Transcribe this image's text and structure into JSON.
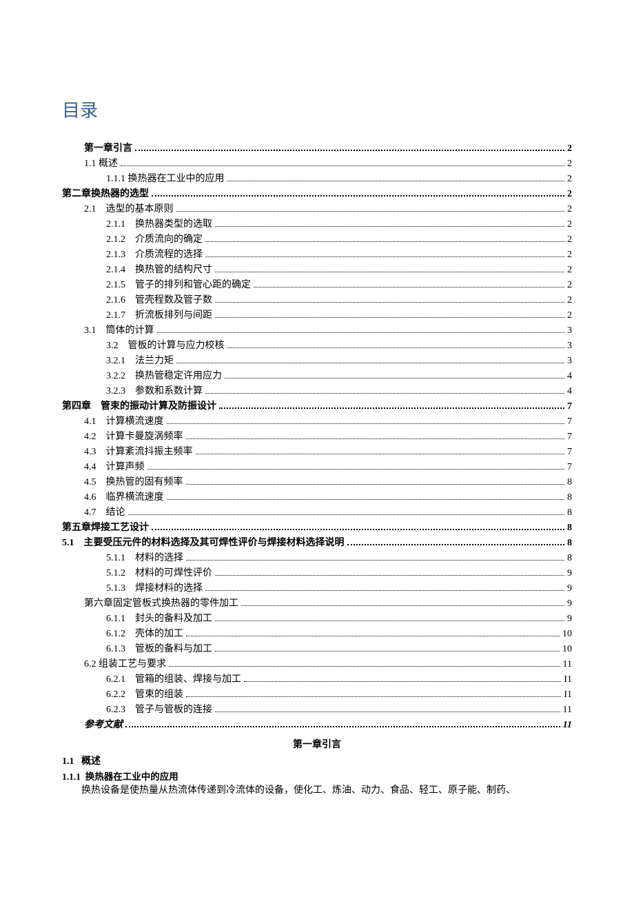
{
  "title": "目录",
  "toc": [
    {
      "indent": "ind0b",
      "num": "",
      "label": "第一章引言",
      "page": "2",
      "bold": true
    },
    {
      "indent": "ind1",
      "num": "",
      "label": "1.1 概述",
      "page": "2",
      "bold": false
    },
    {
      "indent": "ind2",
      "num": "",
      "label": "1.1.1 换热器在工业中的应用",
      "page": "2",
      "bold": false
    },
    {
      "indent": "ind0",
      "num": "",
      "label": "第二章换热器的选型",
      "page": "2",
      "bold": true
    },
    {
      "indent": "ind1",
      "num": "2.1",
      "label": "选型的基本原则",
      "page": "2",
      "bold": false
    },
    {
      "indent": "ind2",
      "num": "2.1.1",
      "label": "换热器类型的选取",
      "page": "2",
      "bold": false
    },
    {
      "indent": "ind2",
      "num": "2.1.2",
      "label": "介质流向的确定",
      "page": "2",
      "bold": false
    },
    {
      "indent": "ind2",
      "num": "2.1.3",
      "label": "介质流程的选择",
      "page": "2",
      "bold": false
    },
    {
      "indent": "ind2",
      "num": "2.1.4",
      "label": "换热管的结构尺寸",
      "page": "2",
      "bold": false
    },
    {
      "indent": "ind2",
      "num": "2.1.5",
      "label": "管子的排列和管心距的确定",
      "page": "2",
      "bold": false
    },
    {
      "indent": "ind2",
      "num": "2.1.6",
      "label": "管壳程数及管子数",
      "page": "2",
      "bold": false
    },
    {
      "indent": "ind2",
      "num": "2.1.7",
      "label": "折流板排列与间距",
      "page": "2",
      "bold": false
    },
    {
      "indent": "ind1",
      "num": "3.1",
      "label": "筒体的计算",
      "page": "3",
      "bold": false
    },
    {
      "indent": "ind2",
      "num": "3.2",
      "label": "管板的计算与应力校核",
      "page": "3",
      "bold": false
    },
    {
      "indent": "ind2",
      "num": "3.2.1",
      "label": "法兰力矩",
      "page": "3",
      "bold": false
    },
    {
      "indent": "ind2",
      "num": "3.2.2",
      "label": "换热管稳定许用应力",
      "page": "4",
      "bold": false
    },
    {
      "indent": "ind2",
      "num": "3.2.3",
      "label": "参数和系数计算",
      "page": "4",
      "bold": false
    },
    {
      "indent": "ind0",
      "num": "第四章",
      "label": "管束的振动计算及防振设计",
      "page": "7",
      "bold": true
    },
    {
      "indent": "ind1",
      "num": "4.1",
      "label": "计算横流速度",
      "page": "7",
      "bold": false
    },
    {
      "indent": "ind1",
      "num": "4.2",
      "label": "计算卡曼旋涡频率",
      "page": "7",
      "bold": false
    },
    {
      "indent": "ind1",
      "num": "4.3",
      "label": "计算紊流抖振主频率",
      "page": "7",
      "bold": false
    },
    {
      "indent": "ind1",
      "num": "4.4",
      "label": "计算声频",
      "page": "7",
      "bold": false
    },
    {
      "indent": "ind1",
      "num": "4.5",
      "label": "换热管的固有频率",
      "page": "8",
      "bold": false
    },
    {
      "indent": "ind1",
      "num": "4.6",
      "label": "临界横流速度",
      "page": "8",
      "bold": false
    },
    {
      "indent": "ind1",
      "num": "4.7",
      "label": "结论",
      "page": "8",
      "bold": false
    },
    {
      "indent": "ind0",
      "num": "",
      "label": "第五章焊接工艺设计",
      "page": "8",
      "bold": true
    },
    {
      "indent": "ind0",
      "num": "5.1",
      "label": "主要受压元件的材料选择及其可焊性评价与焊接材料选择说明",
      "page": "8",
      "bold": true
    },
    {
      "indent": "ind2",
      "num": "5.1.1",
      "label": "材料的选择",
      "page": "8",
      "bold": false
    },
    {
      "indent": "ind2",
      "num": "5.1.2",
      "label": "材料的可焊性评价",
      "page": "9",
      "bold": false
    },
    {
      "indent": "ind2",
      "num": "5.1.3",
      "label": "焊接材料的选择",
      "page": "9",
      "bold": false
    },
    {
      "indent": "ind1",
      "num": "",
      "label": "第六章固定管板式换热器的零件加工",
      "page": "9",
      "bold": false
    },
    {
      "indent": "ind2",
      "num": "6.1.1",
      "label": "封头的备料及加工",
      "page": "9",
      "bold": false
    },
    {
      "indent": "ind2",
      "num": "6.1.2",
      "label": "壳体的加工",
      "page": "10",
      "bold": false
    },
    {
      "indent": "ind2",
      "num": "6.1.3",
      "label": "管板的备料与加工",
      "page": "10",
      "bold": false
    },
    {
      "indent": "ind1",
      "num": "",
      "label": "6.2 组装工艺与要求",
      "page": "11",
      "bold": false
    },
    {
      "indent": "ind2",
      "num": "6.2.1",
      "label": "管箱的组装、焊接与加工",
      "page": "I1",
      "bold": false
    },
    {
      "indent": "ind2",
      "num": "6.2.2",
      "label": "管束的组装",
      "page": "I1",
      "bold": false
    },
    {
      "indent": "ind2",
      "num": "6.2.3",
      "label": "管子与管板的连接",
      "page": "11",
      "bold": false
    },
    {
      "indent": "ind1",
      "num": "",
      "label": "参考文献",
      "page": "11",
      "bold": true,
      "italic": true
    }
  ],
  "body": {
    "chapter_heading": "第一章引言",
    "sec1_num": "1.1",
    "sec1_label": "概述",
    "sec11_num": "1.1.1",
    "sec11_label": "换热器在工业中的应用",
    "paragraph": "换热设备是使热量从热流体传递到冷流体的设备，使化工、炼油、动力、食品、轻工、原子能、制药、"
  }
}
